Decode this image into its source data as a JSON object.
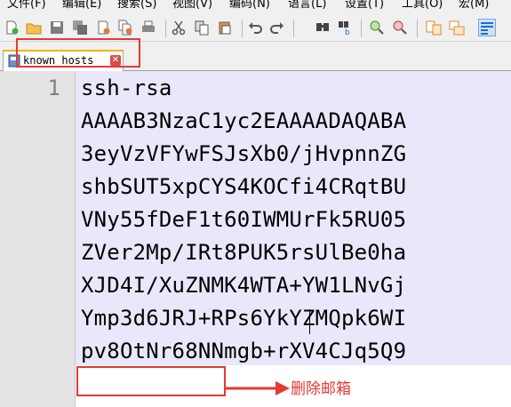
{
  "menubar": {
    "items": [
      "文件(F)",
      "编辑(E)",
      "搜索(S)",
      "视图(V)",
      "编码(N)",
      "语言(L)",
      "设置(T)",
      "工具(O)",
      "宏(M)"
    ]
  },
  "toolbar": {
    "icons": [
      "new-file-icon",
      "open-file-icon",
      "save-icon",
      "save-all-icon",
      "close-icon",
      "close-all-icon",
      "print-icon",
      "cut-icon",
      "copy-icon",
      "paste-icon",
      "undo-icon",
      "redo-icon",
      "find-icon",
      "replace-icon",
      "zoom-in-icon",
      "zoom-out-icon",
      "sync-vertical-icon",
      "sync-horizontal-icon",
      "word-wrap-icon"
    ]
  },
  "tabs": [
    {
      "label": "known_hosts",
      "active": true
    }
  ],
  "editor": {
    "line_number": "1",
    "lines": [
      "ssh-rsa",
      "AAAAB3NzaC1yc2EAAAADAQABA",
      "3eyVzVFYwFSJsXb0/jHvpnnZG",
      "shbSUT5xpCYS4KOCfi4CRqtBU",
      "VNy55fDeF1t60IWMUrFk5RU05",
      "ZVer2Mp/IRt8PUK5rsUlBe0ha",
      "XJD4I/XuZNMK4WTA+YW1LNvGj",
      "Ymp3d6JRJ+RPs6YkYZMQpk6WI",
      "pv8OtNr68NNmgb+rXV4CJq5Q9"
    ]
  },
  "annotation": {
    "text": "删除邮箱",
    "color": "#e53935"
  },
  "colors": {
    "selection": "#e8e8fa",
    "gutter": "#e4e4e4",
    "tab_accent": "#f0b400"
  }
}
